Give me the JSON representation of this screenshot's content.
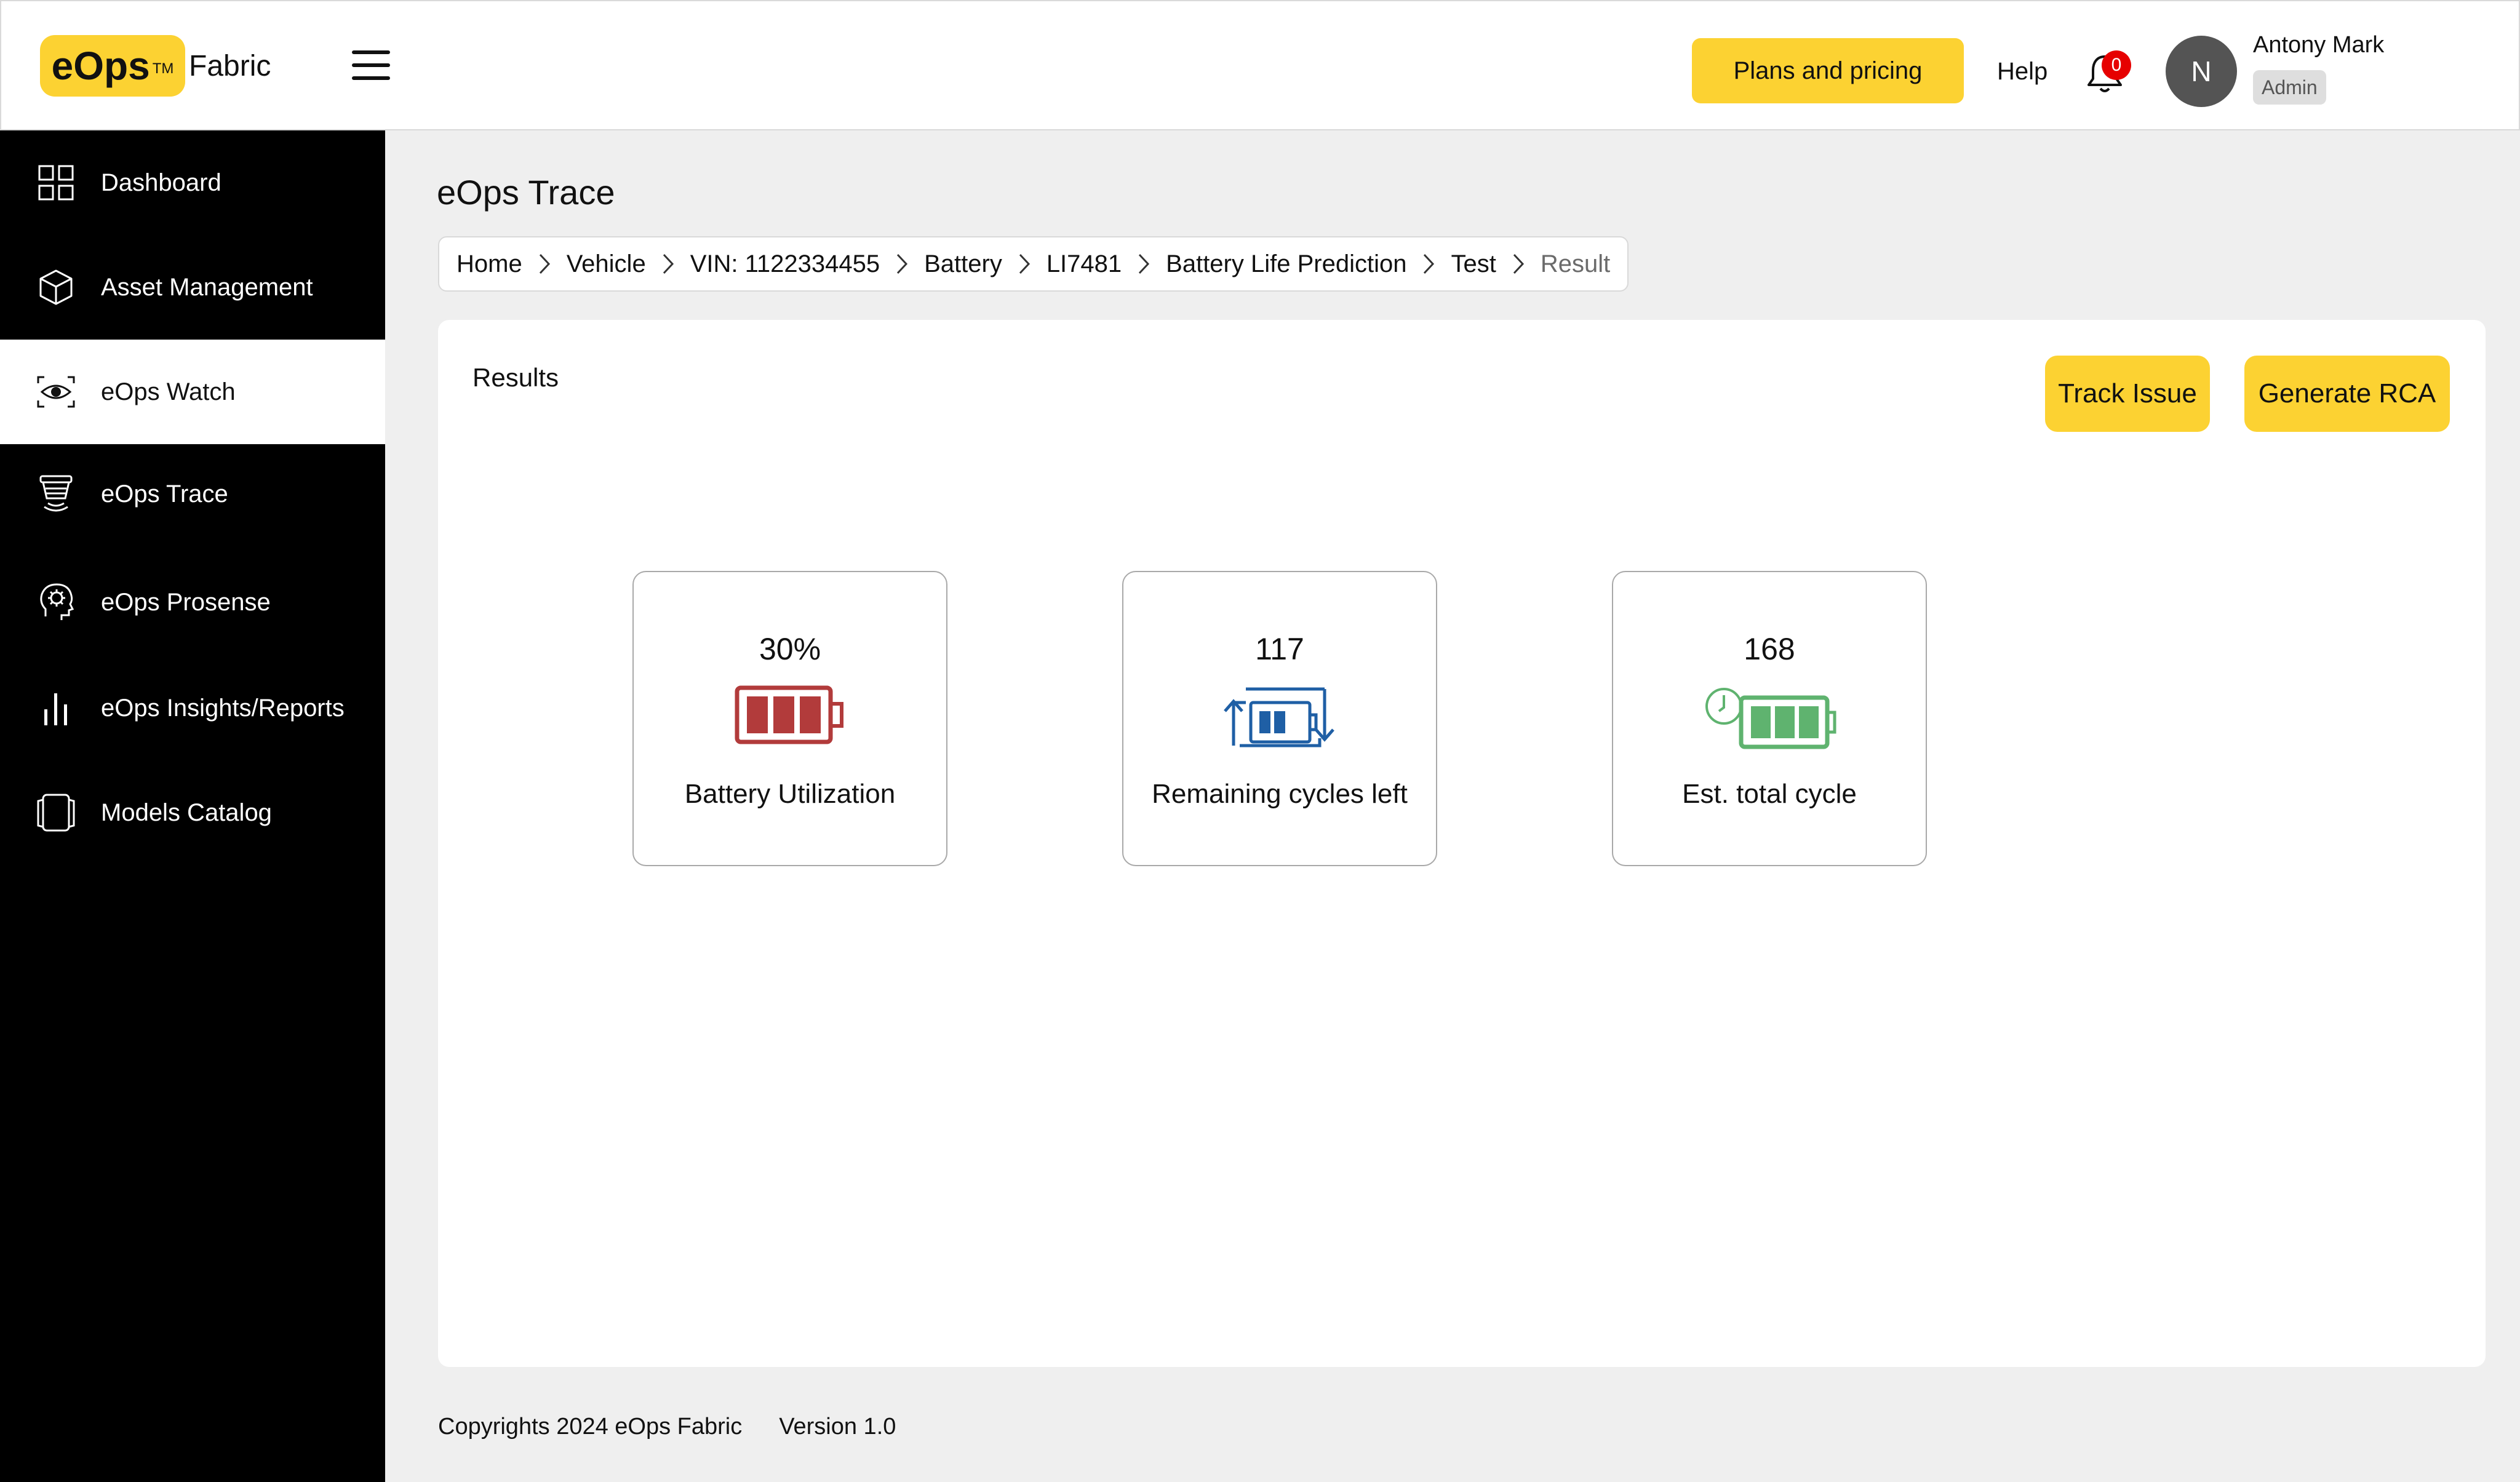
{
  "app": {
    "logo_text": "eOps",
    "logo_tm": "TM",
    "logo_suffix": "Fabric"
  },
  "header": {
    "plans_label": "Plans and pricing",
    "help_label": "Help",
    "notification_count": "0",
    "avatar_initial": "N",
    "user_name": "Antony Mark",
    "user_role": "Admin"
  },
  "sidebar": {
    "items": [
      {
        "label": "Dashboard",
        "icon": "grid-icon"
      },
      {
        "label": "Asset Management",
        "icon": "cube-icon"
      },
      {
        "label": "eOps Watch",
        "icon": "eye-scan-icon",
        "active": true
      },
      {
        "label": "eOps Trace",
        "icon": "trace-icon"
      },
      {
        "label": "eOps Prosense",
        "icon": "brain-icon"
      },
      {
        "label": "eOps Insights/Reports",
        "icon": "bar-chart-icon"
      },
      {
        "label": "Models Catalog",
        "icon": "catalog-icon"
      }
    ]
  },
  "main": {
    "title": "eOps Trace",
    "breadcrumb": [
      "Home",
      "Vehicle",
      "VIN: 1122334455",
      "Battery",
      "LI7481",
      "Battery Life Prediction",
      "Test",
      "Result"
    ],
    "results_label": "Results",
    "track_issue_label": "Track Issue",
    "generate_rca_label": "Generate RCA",
    "cards": [
      {
        "value": "30%",
        "label": "Battery Utilization",
        "icon": "battery-red-icon",
        "color": "#b23b3b"
      },
      {
        "value": "117",
        "label": "Remaining cycles left",
        "icon": "battery-cycle-icon",
        "color": "#1f5fa5"
      },
      {
        "value": "168",
        "label": "Est. total cycle",
        "icon": "battery-clock-icon",
        "color": "#5fb36f"
      }
    ]
  },
  "footer": {
    "copyright": "Copyrights 2024 eOps Fabric",
    "version": "Version 1.0"
  },
  "colors": {
    "accent": "#fcd232",
    "sidebar_bg": "#000000",
    "page_bg": "#efefef"
  }
}
